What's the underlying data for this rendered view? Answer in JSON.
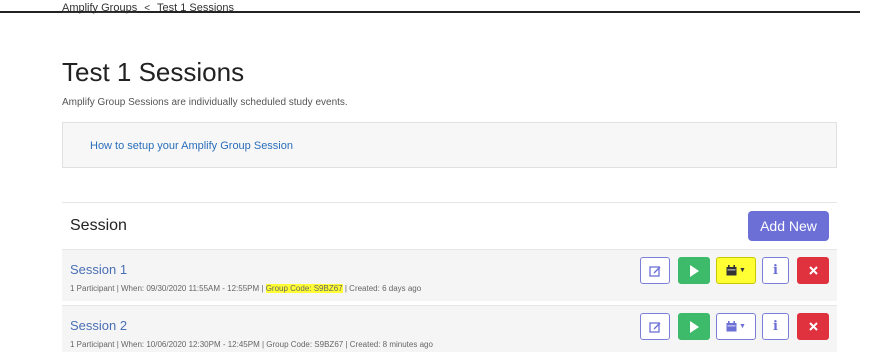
{
  "breadcrumb": {
    "parent": "Amplify Groups",
    "separator": "<",
    "current": "Test 1 Sessions"
  },
  "page": {
    "title": "Test 1 Sessions",
    "subtitle": "Amplify Group Sessions are individually scheduled study events."
  },
  "help": {
    "link_text": "How to setup your Amplify Group Session"
  },
  "panel": {
    "title": "Session",
    "add_button": "Add New"
  },
  "sessions": [
    {
      "name": "Session 1",
      "meta_before": "1 Participant | When: 09/30/2020 11:55AM - 12:55PM |",
      "group_code": "Group Code: S9BZ67",
      "meta_after": "| Created: 6 days ago",
      "calendar_highlighted": true
    },
    {
      "name": "Session 2",
      "meta_before": "1 Participant | When: 10/06/2020 12:30PM - 12:45PM |",
      "group_code": "Group Code: S9BZ67",
      "meta_after": "| Created: 8 minutes ago",
      "calendar_highlighted": false
    }
  ],
  "icons": {
    "edit": "edit-icon",
    "play": "play-icon",
    "calendar": "calendar-icon",
    "info": "info-icon",
    "delete": "close-icon"
  },
  "colors": {
    "accent": "#6b6fd6",
    "success": "#3dbb6a",
    "danger": "#e0313e",
    "highlight": "#ffff33",
    "link": "#2a6ebb"
  }
}
